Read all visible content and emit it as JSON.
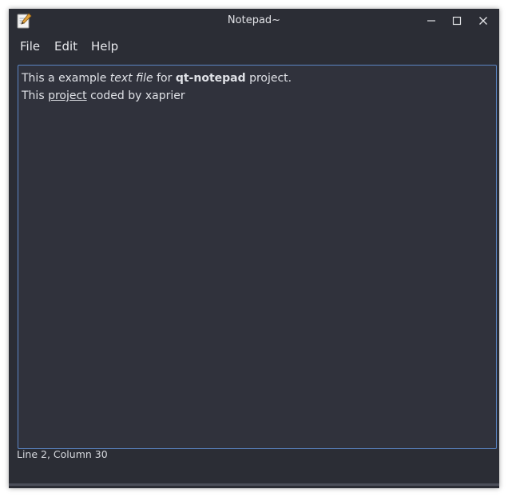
{
  "window": {
    "title": "Notepad~",
    "app_icon": "notepad-icon"
  },
  "titlebar_buttons": {
    "minimize_icon": "minimize-icon",
    "maximize_icon": "maximize-icon",
    "close_icon": "close-icon"
  },
  "menu": {
    "file": "File",
    "edit": "Edit",
    "help": "Help"
  },
  "editor": {
    "line1": {
      "part1": "This a example ",
      "part2_italic": "text file",
      "part3": " for ",
      "part4_bold": "qt-notepad",
      "part5": " project."
    },
    "line2": {
      "part1": "This ",
      "part2_underline": "project",
      "part3": " coded by xaprier"
    }
  },
  "status": {
    "text": "Line 2, Column 30"
  },
  "colors": {
    "background": "#2b2d35",
    "editor_background": "#30323c",
    "editor_border": "#5b86c5",
    "text": "#dfe1e6"
  }
}
